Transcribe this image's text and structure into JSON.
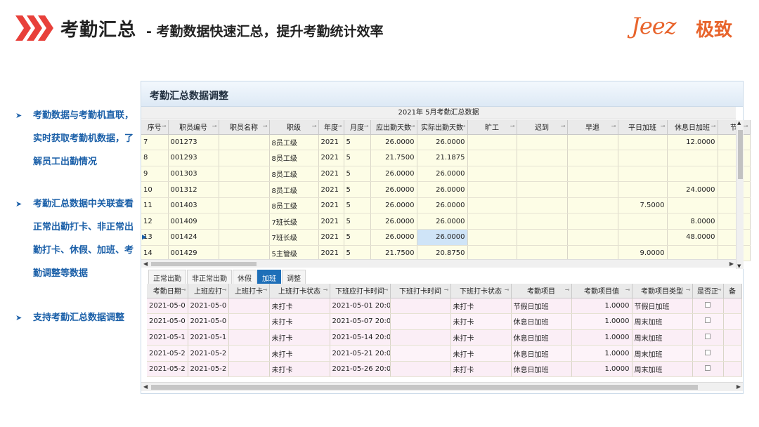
{
  "header": {
    "title": "考勤汇总",
    "subtitle": "- 考勤数据快速汇总，提升考勤统计效率",
    "logo_latin": "Jeez",
    "logo_cn": "极致",
    "chevron_color": "#e8403a",
    "accent_color": "#e8642c"
  },
  "bullets": [
    {
      "icon": "triangle-right-icon",
      "text": "考勤数据与考勤机直联，实时获取考勤机数据，了解员工出勤情况"
    },
    {
      "icon": "triangle-right-icon",
      "text": "考勤汇总数据中关联查看正常出勤打卡、非正常出勤打卡、休假、加班、考勤调整等数据"
    },
    {
      "icon": "triangle-right-icon",
      "text": "支持考勤汇总数据调整"
    }
  ],
  "window": {
    "title": "考勤汇总数据调整",
    "caption": "2021年   5月考勤汇总数据"
  },
  "top_grid": {
    "columns": [
      "序号",
      "职员编号",
      "职员名称",
      "职级",
      "年度",
      "月度",
      "应出勤天数",
      "实际出勤天数",
      "旷工",
      "迟到",
      "早退",
      "平日加班",
      "休息日加班",
      "节"
    ],
    "rows": [
      [
        "7",
        "001273",
        "",
        "8员工级",
        "2021",
        "5",
        "26.0000",
        "26.0000",
        "",
        "",
        "",
        "",
        "12.0000",
        ""
      ],
      [
        "8",
        "001293",
        "",
        "8员工级",
        "2021",
        "5",
        "21.7500",
        "21.1875",
        "",
        "",
        "",
        "",
        "",
        ""
      ],
      [
        "9",
        "001303",
        "",
        "8员工级",
        "2021",
        "5",
        "26.0000",
        "26.0000",
        "",
        "",
        "",
        "",
        "",
        ""
      ],
      [
        "10",
        "001312",
        "",
        "8员工级",
        "2021",
        "5",
        "26.0000",
        "26.0000",
        "",
        "",
        "",
        "",
        "24.0000",
        ""
      ],
      [
        "11",
        "001403",
        "",
        "8员工级",
        "2021",
        "5",
        "26.0000",
        "26.0000",
        "",
        "",
        "",
        "7.5000",
        "",
        ""
      ],
      [
        "12",
        "001409",
        "",
        "7班长级",
        "2021",
        "5",
        "26.0000",
        "26.0000",
        "",
        "",
        "",
        "",
        "8.0000",
        ""
      ],
      [
        "13",
        "001424",
        "",
        "7班长级",
        "2021",
        "5",
        "26.0000",
        "26.0000",
        "",
        "",
        "",
        "",
        "48.0000",
        ""
      ],
      [
        "14",
        "001429",
        "",
        "5主管级",
        "2021",
        "5",
        "21.7500",
        "20.8750",
        "",
        "",
        "",
        "9.0000",
        "",
        ""
      ]
    ]
  },
  "tabs": [
    "正常出勤",
    "非正常出勤",
    "休假",
    "加班",
    "调整"
  ],
  "active_tab": "加班",
  "bottom_grid": {
    "columns": [
      "考勤日期",
      "上班应打",
      "上班打卡",
      "上班打卡状态",
      "下班应打卡时间",
      "下班打卡时间",
      "下班打卡状态",
      "考勤项目",
      "考勤项目值",
      "考勤项目类型",
      "是否正",
      "备"
    ],
    "rows": [
      [
        "2021-05-0",
        "2021-05-0",
        "",
        "未打卡",
        "2021-05-01 20:0",
        "",
        "未打卡",
        "节假日加班",
        "1.0000",
        "节假日加班"
      ],
      [
        "2021-05-0",
        "2021-05-0",
        "",
        "未打卡",
        "2021-05-07 20:0",
        "",
        "未打卡",
        "休息日加班",
        "1.0000",
        "周末加班"
      ],
      [
        "2021-05-1",
        "2021-05-1",
        "",
        "未打卡",
        "2021-05-14 20:0",
        "",
        "未打卡",
        "休息日加班",
        "1.0000",
        "周末加班"
      ],
      [
        "2021-05-2",
        "2021-05-2",
        "",
        "未打卡",
        "2021-05-21 20:0",
        "",
        "未打卡",
        "休息日加班",
        "1.0000",
        "周末加班"
      ],
      [
        "2021-05-2",
        "2021-05-2",
        "",
        "未打卡",
        "2021-05-26 20:0",
        "",
        "未打卡",
        "休息日加班",
        "1.0000",
        "周末加班"
      ]
    ]
  }
}
